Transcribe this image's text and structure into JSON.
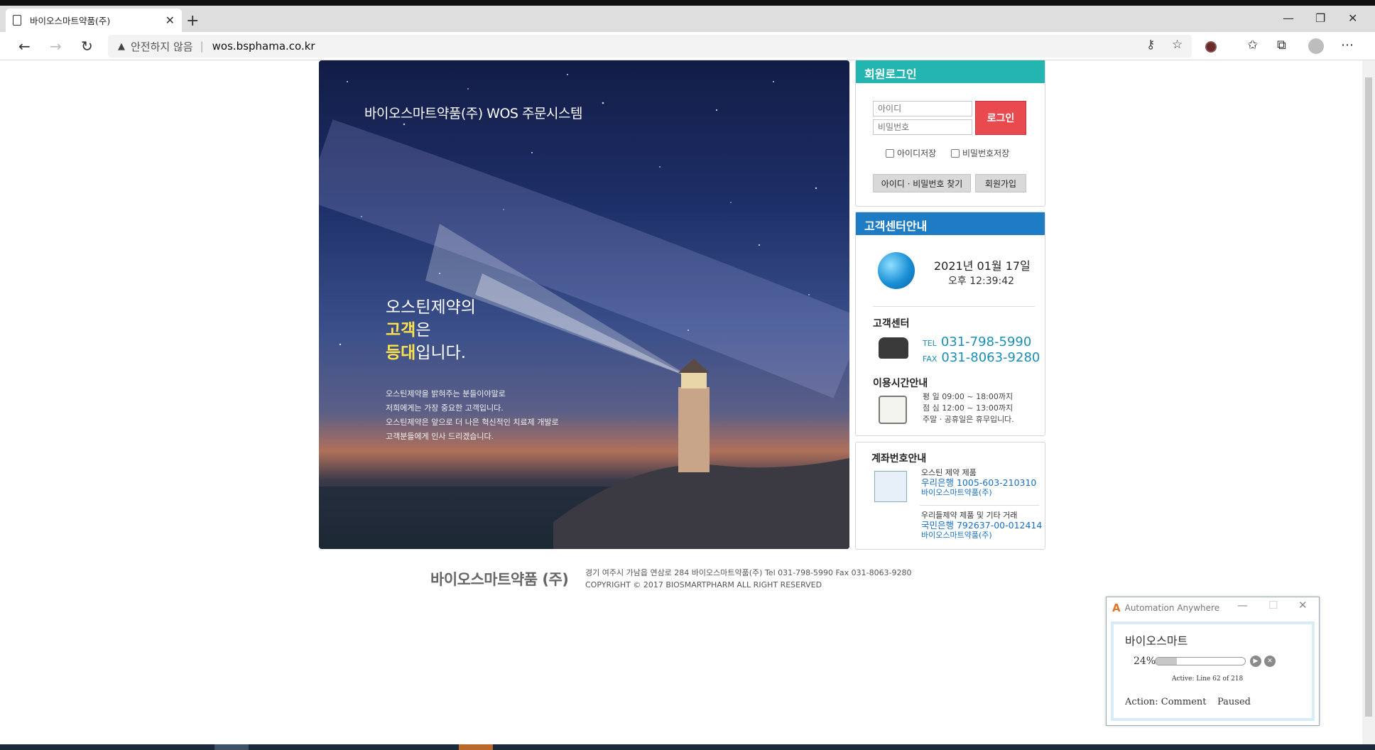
{
  "browser": {
    "tab_title": "바이오스마트약품(주)",
    "security_label": "안전하지 않음",
    "url": "wos.bsphama.co.kr"
  },
  "hero": {
    "title": "바이오스마트약품(주) WOS 주문시스템",
    "slogan_line1": "오스틴제약의",
    "slogan_hl2": "고객",
    "slogan_rest2": "은",
    "slogan_hl3": "등대",
    "slogan_rest3": "입니다.",
    "desc": [
      "오스틴제약을 밝혀주는 분들이야말로",
      "저희에게는 가장 중요한 고객입니다.",
      "오스틴제약은 앞으로 더 나은 혁신적인 치료제 개발로",
      "고객분들에게 인사 드리겠습니다."
    ]
  },
  "login": {
    "heading": "회원로그인",
    "id_placeholder": "아이디",
    "pw_placeholder": "비밀번호",
    "login_button": "로그인",
    "save_id": "아이디저장",
    "save_pw": "비밀번호저장",
    "find_button": "아이디 · 비밀번호 찾기",
    "join_button": "회원가입"
  },
  "customer_center": {
    "heading": "고객센터안내",
    "date": "2021년 01월 17일",
    "time": "오후 12:39:42",
    "center_label": "고객센터",
    "tel_label": "TEL",
    "tel": "031-798-5990",
    "fax_label": "FAX",
    "fax": "031-8063-9280",
    "hours_label": "이용시간안내",
    "hours": [
      "평  일   09:00 ~ 18:00까지",
      "점  심   12:00 ~ 13:00까지",
      "주말 · 공휴일은 휴무입니다."
    ]
  },
  "accounts": {
    "heading": "계좌번호안내",
    "items": [
      {
        "caption": "오스틴 제약 제품",
        "account": "우리은행 1005-603-210310",
        "owner": "바이오스마트약품(주)"
      },
      {
        "caption": "우리들제약 제품 및 기타 거래",
        "account": "국민은행 792637-00-012414",
        "owner": "바이오스마트약품(주)"
      }
    ]
  },
  "footer": {
    "brand": "바이오스마트약품 (주)",
    "address": "경기 여주시 가남읍 연삼로 284 바이오스마트약품(주) Tel 031-798-5990  Fax 031-8063-9280",
    "copyright": "COPYRIGHT © 2017 BIOSMARTPHARM  ALL RIGHT RESERVED"
  },
  "automation": {
    "app_title": "Automation Anywhere",
    "bot_name": "바이오스마트",
    "progress_text": "24%",
    "progress_fraction": 0.24,
    "active_line": "Active: Line 62 of 218",
    "action": "Action: Comment",
    "status": "Paused"
  }
}
